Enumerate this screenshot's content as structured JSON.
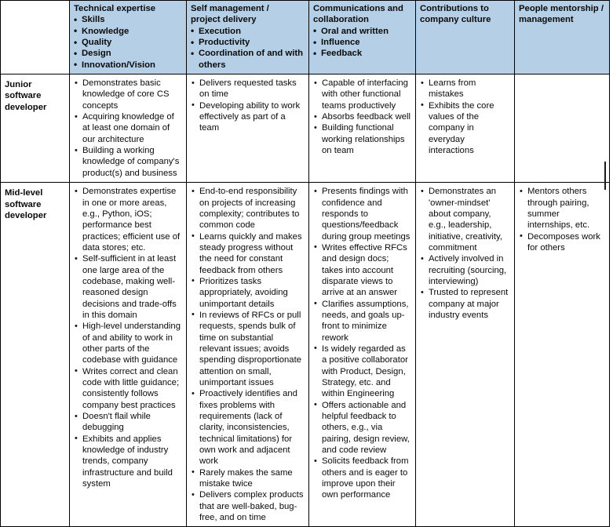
{
  "table": {
    "columns": [
      {
        "key": "level",
        "header_title": "",
        "header_bullets": []
      },
      {
        "key": "technical_expertise",
        "header_title": "Technical expertise",
        "header_bullets": [
          "Skills",
          "Knowledge",
          "Quality",
          "Design",
          "Innovation/Vision"
        ]
      },
      {
        "key": "self_management",
        "header_title": "Self management /\nproject delivery",
        "header_bullets": [
          "Execution",
          "Productivity",
          "Coordination of and with others"
        ]
      },
      {
        "key": "communications",
        "header_title": "Communications and collaboration",
        "header_bullets": [
          "Oral and written",
          "Influence",
          "Feedback"
        ]
      },
      {
        "key": "culture",
        "header_title": "Contributions to company culture",
        "header_bullets": []
      },
      {
        "key": "mentorship",
        "header_title": "People mentorship / management",
        "header_bullets": []
      }
    ],
    "rows": [
      {
        "level": "Junior software developer",
        "technical_expertise": [
          "Demonstrates basic knowledge of core CS concepts",
          "Acquiring knowledge of at least one domain of our architecture",
          "Building a working knowledge of company's product(s) and business"
        ],
        "self_management": [
          "Delivers requested tasks on time",
          "Developing ability to work effectively as part of a team"
        ],
        "communications": [
          "Capable of interfacing with other functional teams productively",
          "Absorbs feedback well",
          "Building functional working relationships on team"
        ],
        "culture": [
          "Learns from mistakes",
          "Exhibits the core values of the company in everyday interactions"
        ],
        "mentorship": []
      },
      {
        "level": "Mid-level software developer",
        "technical_expertise": [
          "Demonstrates expertise in one or more areas, e.g., Python, iOS; performance best practices; efficient use of data stores; etc.",
          "Self-sufficient in at least one large area of the codebase, making well-reasoned design decisions and trade-offs in this domain",
          "High-level understanding of and ability to work in other parts of the codebase with guidance",
          "Writes correct and clean code with little guidance; consistently follows company best practices",
          "Doesn't flail while debugging",
          "Exhibits and applies knowledge of industry trends, company infrastructure and build system"
        ],
        "self_management": [
          "End-to-end responsibility on projects of increasing complexity; contributes to common code",
          "Learns quickly and makes steady progress without the need for constant feedback from others",
          "Prioritizes tasks appropriately, avoiding unimportant details",
          "In reviews of RFCs or pull requests, spends bulk of time on substantial relevant issues; avoids spending disproportionate attention on small, unimportant issues",
          "Proactively identifies and fixes problems with requirements (lack of clarity, inconsistencies, technical limitations) for own work and adjacent work",
          "Rarely makes the same mistake twice",
          "Delivers complex products that are well-baked, bug-free, and on time"
        ],
        "communications": [
          "Presents findings with confidence and responds to questions/feedback during group meetings",
          "Writes effective RFCs and design docs; takes into account disparate views to arrive at an answer",
          "Clarifies assumptions, needs, and goals up-front to minimize rework",
          "Is widely regarded as a positive collaborator with Product, Design, Strategy, etc. and within Engineering",
          "Offers actionable and helpful feedback to others, e.g., via pairing, design review, and code review",
          "Solicits feedback from others and is eager to improve upon their own performance"
        ],
        "culture": [
          "Demonstrates an 'owner-mindset' about company, e.g., leadership, initiative, creativity, commitment",
          "Actively involved in recruiting (sourcing, interviewing)",
          "Trusted to represent company at major industry events"
        ],
        "mentorship": [
          "Mentors others through pairing, summer internships, etc.",
          "Decomposes work for others"
        ]
      }
    ]
  },
  "colors": {
    "header_background": "#b5cfe7",
    "border": "#000000",
    "text": "#0b0b0b",
    "page_background": "#ffffff"
  }
}
